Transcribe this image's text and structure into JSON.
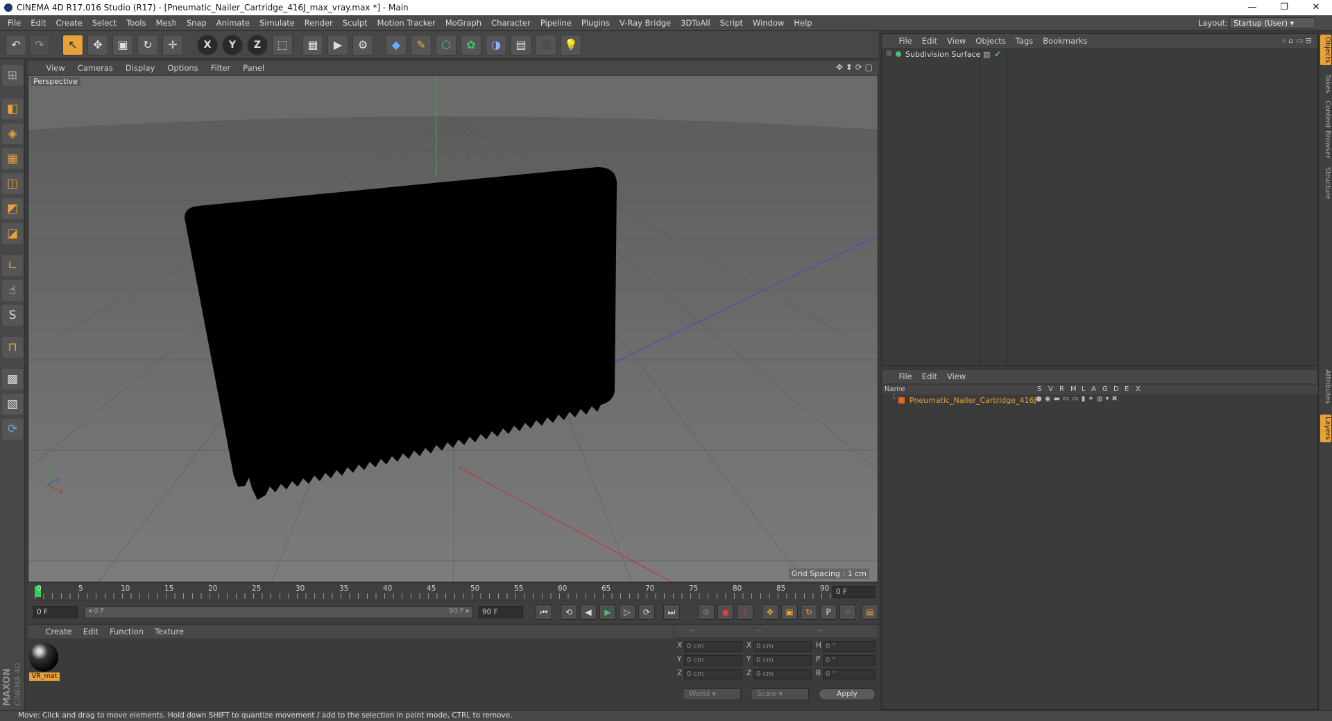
{
  "window": {
    "title": "CINEMA 4D R17.016 Studio (R17) - [Pneumatic_Nailer_Cartridge_416J_max_vray.max *] - Main",
    "minimize": "—",
    "restore": "❐",
    "close": "✕"
  },
  "menubar": {
    "items": [
      "File",
      "Edit",
      "Create",
      "Select",
      "Tools",
      "Mesh",
      "Snap",
      "Animate",
      "Simulate",
      "Render",
      "Sculpt",
      "Motion Tracker",
      "MoGraph",
      "Character",
      "Pipeline",
      "Plugins",
      "V-Ray Bridge",
      "3DToAll",
      "Script",
      "Window",
      "Help"
    ],
    "layout_label": "Layout:",
    "layout_value": "Startup (User)"
  },
  "toolbar": {
    "undo": "↶",
    "redo": "↷",
    "live": "↖",
    "move": "✥",
    "scale": "▣",
    "rotate": "↻",
    "last": "✛",
    "x": "X",
    "y": "Y",
    "z": "Z",
    "coords": "⬚",
    "render_view": "▦",
    "render": "▶",
    "render_settings": "⚙",
    "cube": "◆",
    "spline": "✎",
    "nurbs": "⬡",
    "array": "✿",
    "deformer": "◑",
    "scene": "▤",
    "camera": "🎥",
    "light": "💡"
  },
  "lefttools": [
    "⊞",
    "◧",
    "◈",
    "▦",
    "◫",
    "◩",
    "◪",
    "∟",
    "☝",
    "S",
    "⊓",
    "▩",
    "▧",
    "⟳"
  ],
  "viewport": {
    "menu": [
      "View",
      "Cameras",
      "Display",
      "Options",
      "Filter",
      "Panel"
    ],
    "label": "Perspective",
    "grid_spacing": "Grid Spacing : 1 cm",
    "axis_y": "Y",
    "axis_x": "X",
    "axis_z": "Z"
  },
  "timeline": {
    "ticks": [
      "0",
      "5",
      "10",
      "15",
      "20",
      "25",
      "30",
      "35",
      "40",
      "45",
      "50",
      "55",
      "60",
      "65",
      "70",
      "75",
      "80",
      "85",
      "90"
    ],
    "current_frame": "0 F"
  },
  "transport": {
    "start_field": "0 F",
    "range_start": "◂ 0 F",
    "range_end": "90 F ▸",
    "end_field": "90 F",
    "buttons": [
      "⏮",
      "⟲",
      "◀",
      "▶",
      "▷",
      "⟳",
      "⏭"
    ],
    "key_buttons": [
      "⊘",
      "●",
      "?",
      "✥",
      "▣",
      "↻",
      "P",
      "⁘",
      "▤"
    ]
  },
  "materials": {
    "menu": [
      "Create",
      "Edit",
      "Function",
      "Texture"
    ],
    "items": [
      {
        "name": "VR_mat"
      }
    ]
  },
  "coords": {
    "headers": [
      "--",
      "--",
      "--"
    ],
    "rows": [
      {
        "axis": "X",
        "pos": "0 cm",
        "axis2": "X",
        "size": "0 cm",
        "rot_axis": "H",
        "rot": "0 °"
      },
      {
        "axis": "Y",
        "pos": "0 cm",
        "axis2": "Y",
        "size": "0 cm",
        "rot_axis": "P",
        "rot": "0 °"
      },
      {
        "axis": "Z",
        "pos": "0 cm",
        "axis2": "Z",
        "size": "0 cm",
        "rot_axis": "B",
        "rot": "0 °"
      }
    ],
    "mode": "World",
    "size_mode": "Scale",
    "apply": "Apply"
  },
  "objects": {
    "menu": [
      "File",
      "Edit",
      "View",
      "Objects",
      "Tags",
      "Bookmarks"
    ],
    "items": [
      {
        "name": "Subdivision Surface",
        "color": "#3ec46d"
      }
    ]
  },
  "layers": {
    "menu": [
      "File",
      "Edit",
      "View"
    ],
    "columns": {
      "name": "Name",
      "flags": [
        "S",
        "V",
        "R",
        "M",
        "L",
        "A",
        "G",
        "D",
        "E",
        "X"
      ]
    },
    "items": [
      {
        "name": "Pneumatic_Nailer_Cartridge_416J",
        "color": "#e06a1a"
      }
    ]
  },
  "right_tabs": [
    "Objects",
    "Takes",
    "Content Browser",
    "Structure",
    "Attributes",
    "Layers"
  ],
  "brand": {
    "maxon": "MAXON",
    "product": "CINEMA 4D"
  },
  "status": "Move: Click and drag to move elements. Hold down SHIFT to quantize movement / add to the selection in point mode, CTRL to remove."
}
